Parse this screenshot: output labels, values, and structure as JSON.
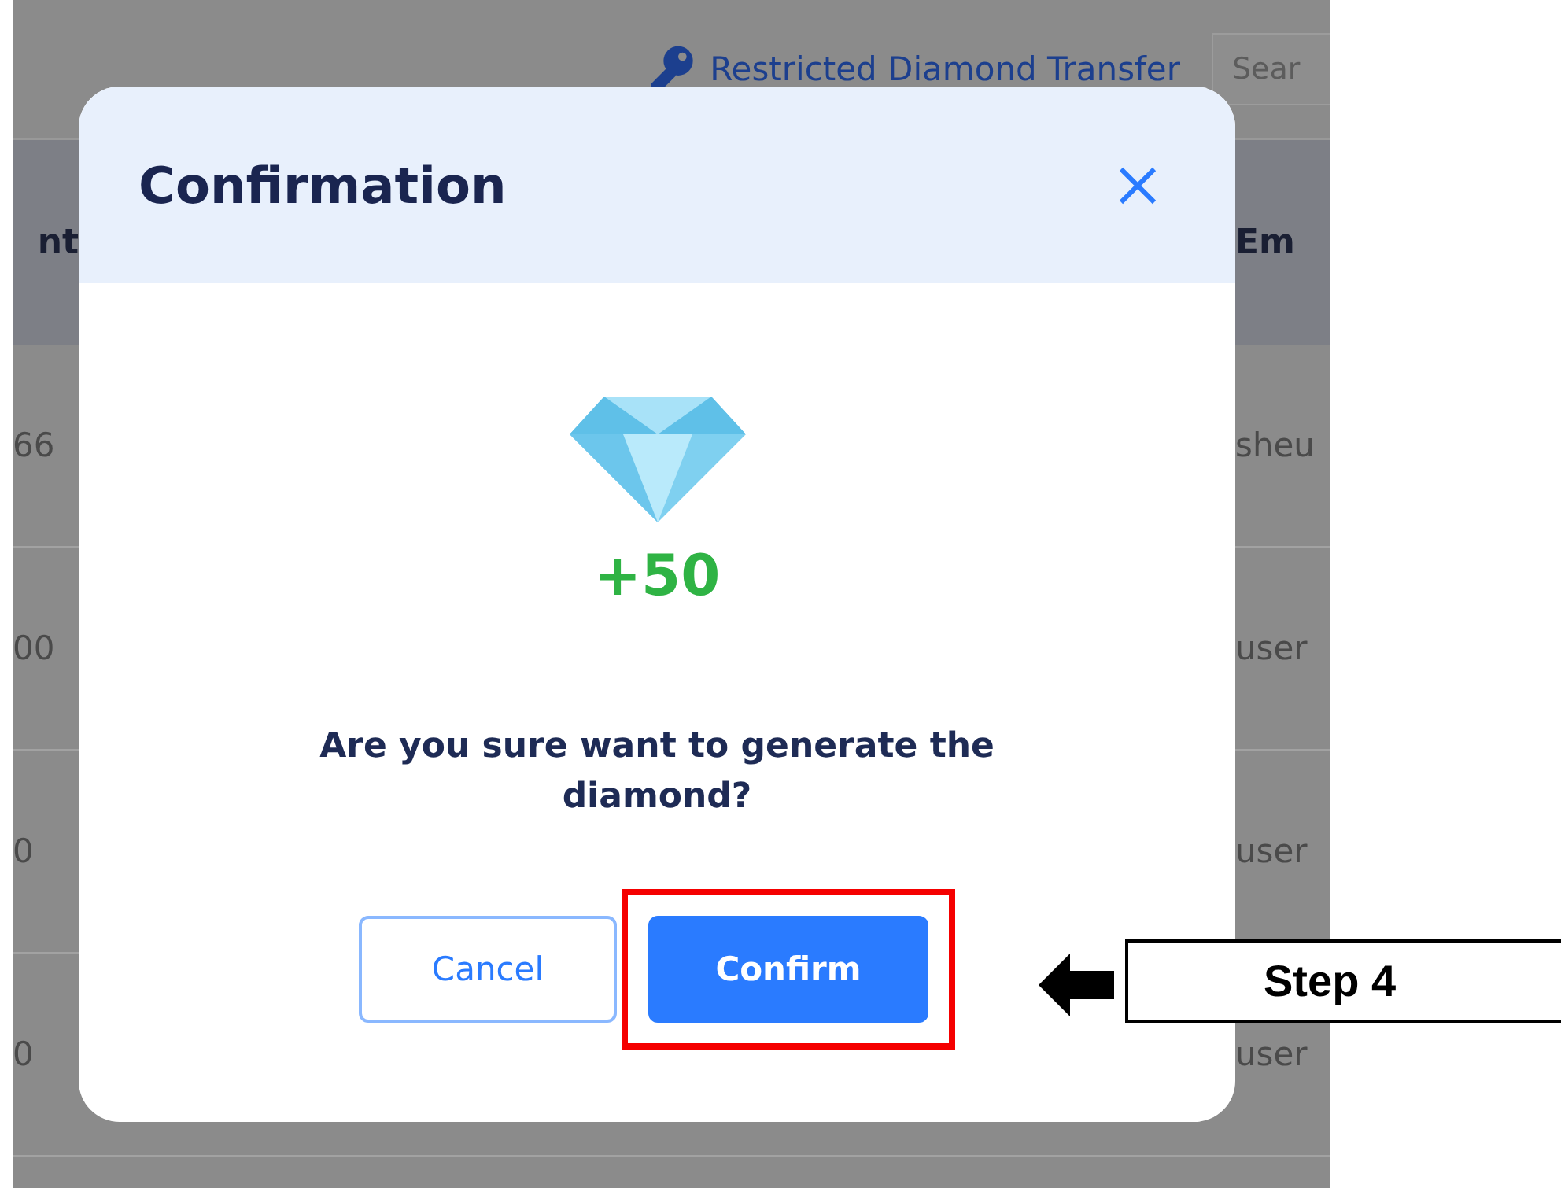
{
  "background_page": {
    "link": "Restricted Diamond Transfer",
    "search": {
      "placeholder": "Sear"
    },
    "table": {
      "columns": [
        "nt",
        "Em"
      ],
      "rows": [
        [
          "66",
          "sheu"
        ],
        [
          "00",
          "user"
        ],
        [
          "0",
          "user"
        ],
        [
          "0",
          "user"
        ]
      ]
    }
  },
  "dialog": {
    "title": "Confirmation",
    "amount": "+50",
    "message": "Are you sure want to generate the diamond?",
    "buttons": [
      {
        "label": "Cancel",
        "kind": "secondary",
        "highlighted": false
      },
      {
        "label": "Confirm",
        "kind": "primary",
        "highlighted": true
      }
    ]
  },
  "annotation": {
    "label": "Step 4"
  }
}
